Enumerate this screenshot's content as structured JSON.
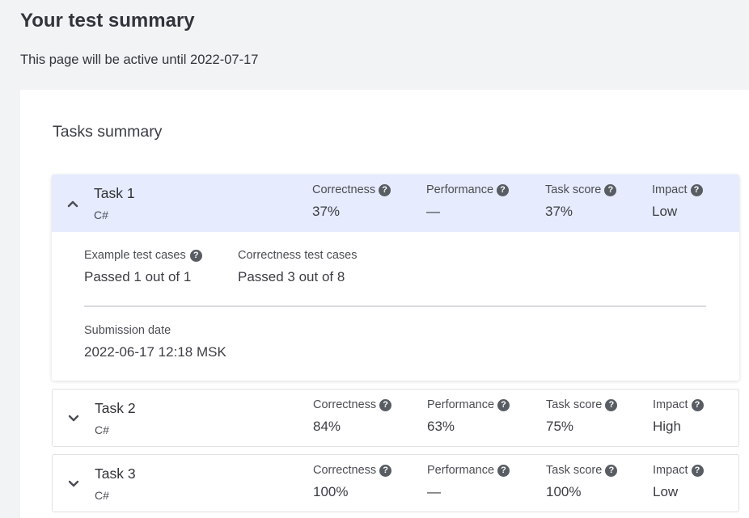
{
  "header": {
    "title": "Your test summary",
    "active_note": "This page will be active until 2022-07-17"
  },
  "summary": {
    "title": "Tasks summary",
    "metric_labels": {
      "correctness": "Correctness",
      "performance": "Performance",
      "task_score": "Task score",
      "impact": "Impact"
    },
    "tasks": [
      {
        "name": "Task 1",
        "language": "C#",
        "expanded": true,
        "correctness": "37%",
        "performance": "—",
        "task_score": "37%",
        "impact": "Low",
        "details": {
          "example_label": "Example test cases",
          "example_value": "Passed 1 out of 1",
          "correctness_label": "Correctness test cases",
          "correctness_value": "Passed 3 out of 8",
          "submission_label": "Submission date",
          "submission_value": "2022-06-17 12:18 MSK"
        }
      },
      {
        "name": "Task 2",
        "language": "C#",
        "expanded": false,
        "correctness": "84%",
        "performance": "63%",
        "task_score": "75%",
        "impact": "High"
      },
      {
        "name": "Task 3",
        "language": "C#",
        "expanded": false,
        "correctness": "100%",
        "performance": "—",
        "task_score": "100%",
        "impact": "Low"
      }
    ]
  },
  "icons": {
    "help": "question-circle-icon",
    "expand": "chevron-down-icon",
    "collapse": "chevron-up-icon"
  },
  "colors": {
    "expanded_header": "#e6ebfd",
    "help_icon": "#585c63",
    "background": "#f2f3f5"
  }
}
